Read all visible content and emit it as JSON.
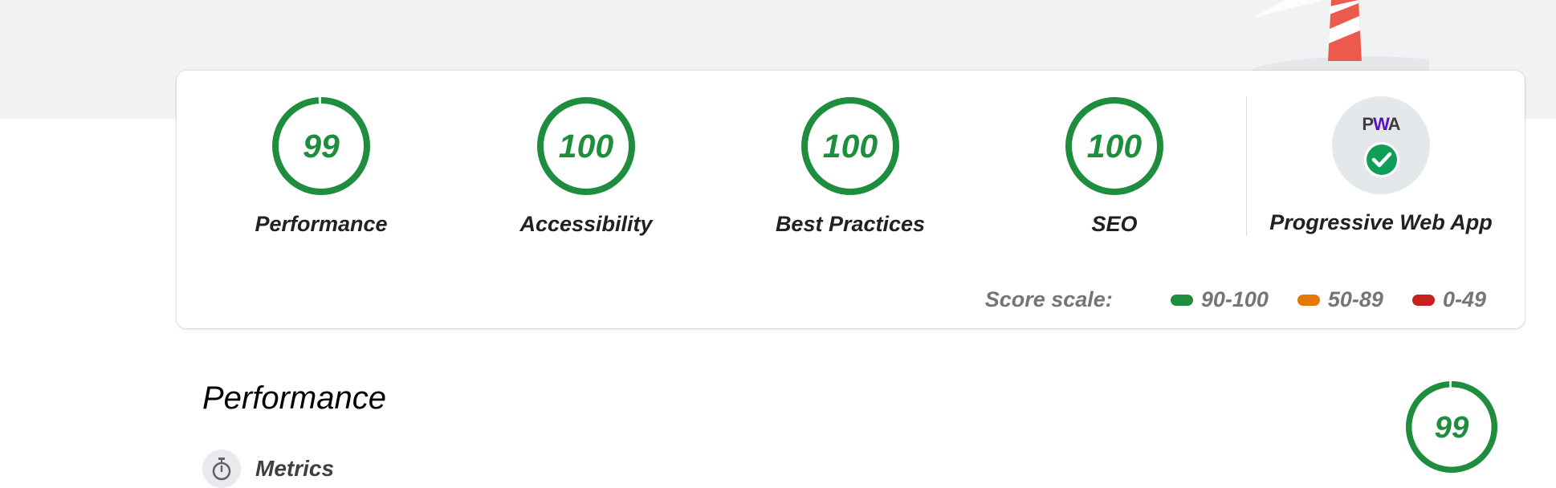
{
  "colors": {
    "pass": "#1e8e3e",
    "average": "#e67700",
    "fail": "#c5221f",
    "pwa_check": "#0f9d58"
  },
  "categories": [
    {
      "name": "Performance",
      "score": "99",
      "value": 0.99
    },
    {
      "name": "Accessibility",
      "score": "100",
      "value": 1.0
    },
    {
      "name": "Best Practices",
      "score": "100",
      "value": 1.0
    },
    {
      "name": "SEO",
      "score": "100",
      "value": 1.0
    }
  ],
  "pwa": {
    "logo_p": "P",
    "logo_w": "W",
    "logo_a": "A",
    "label": "Progressive Web App"
  },
  "score_scale": {
    "title": "Score scale:",
    "ranges": [
      "90-100",
      "50-89",
      "0-49"
    ]
  },
  "section": {
    "title": "Performance",
    "score": "99",
    "value": 0.99,
    "metrics_label": "Metrics"
  }
}
